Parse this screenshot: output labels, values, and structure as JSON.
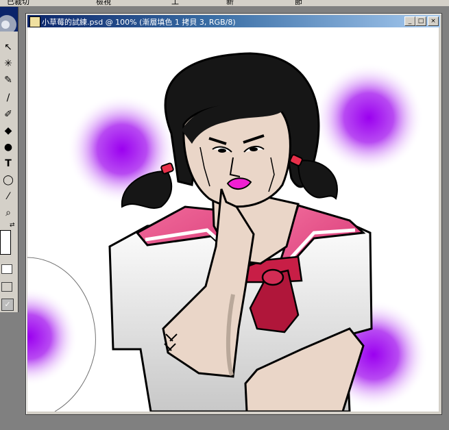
{
  "window": {
    "title": "小草莓的試練.psd @ 100% (漸層填色 1 拷貝 3, RGB/8)",
    "minimize_label": "_",
    "maximize_label": "□",
    "close_label": "×"
  },
  "options_bar": {
    "items": [
      "已裁切",
      "檢視",
      "工",
      "新",
      "節"
    ]
  },
  "toolbox": {
    "tools": [
      {
        "name": "move-tool",
        "glyph": "↖"
      },
      {
        "name": "magic-wand-tool",
        "glyph": "✳"
      },
      {
        "name": "heal-tool",
        "glyph": "✎"
      },
      {
        "name": "brush-tool",
        "glyph": "/"
      },
      {
        "name": "history-brush-tool",
        "glyph": "✐"
      },
      {
        "name": "paint-bucket-tool",
        "glyph": "◆"
      },
      {
        "name": "dodge-tool",
        "glyph": "●"
      },
      {
        "name": "type-tool",
        "glyph": "T"
      },
      {
        "name": "ellipse-tool",
        "glyph": "◯"
      },
      {
        "name": "eyedropper-tool",
        "glyph": "⁄"
      },
      {
        "name": "zoom-tool",
        "glyph": "⌕"
      }
    ],
    "swap_icon": "swap-colors-icon"
  },
  "colors": {
    "title_active": "#0a246a",
    "chrome": "#d4d0c8",
    "purple_glow": "#9b00f0",
    "uniform_pink": "#e8457a",
    "skin": "#ead6c8",
    "hair": "#161616"
  }
}
